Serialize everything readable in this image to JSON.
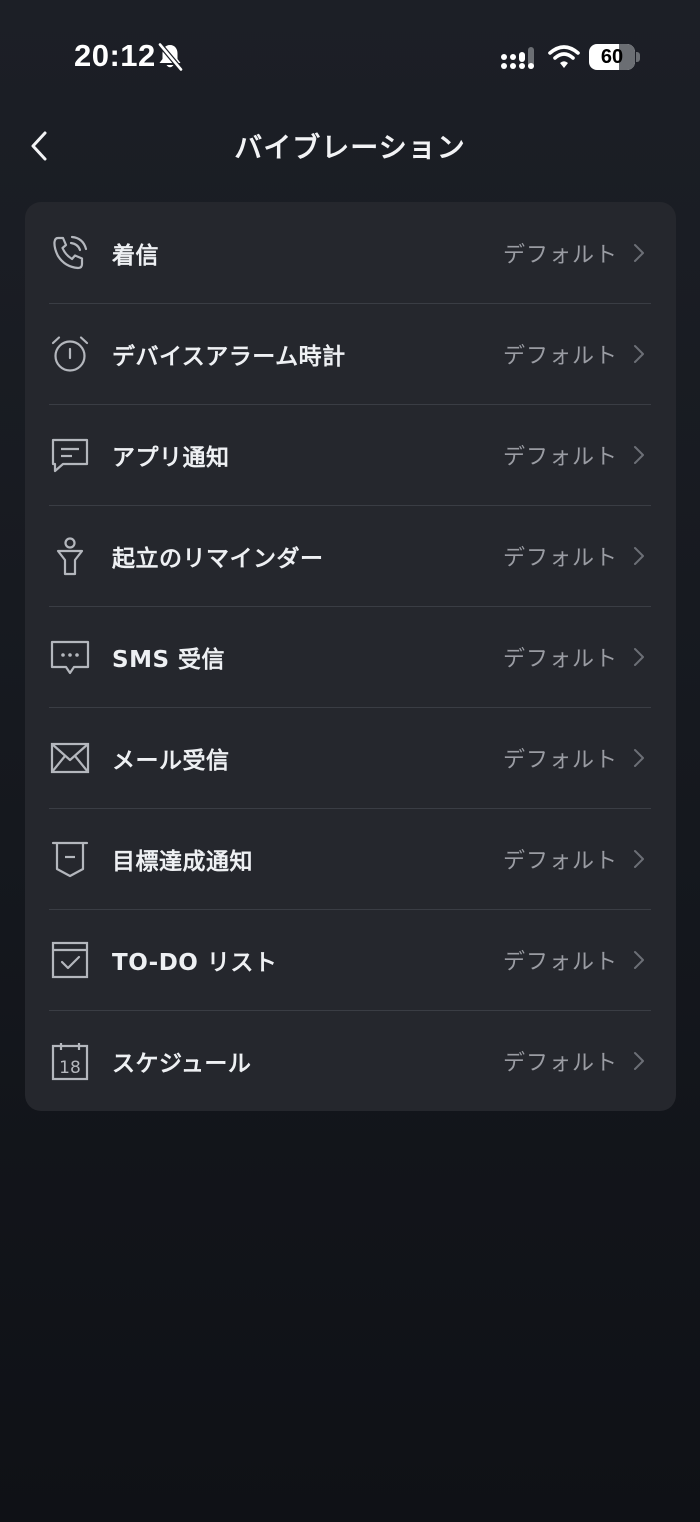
{
  "status_bar": {
    "time": "20:12",
    "battery": "60",
    "icons": [
      "bell-slash-icon",
      "cellular-signal-icon",
      "wifi-icon",
      "battery-icon"
    ]
  },
  "header": {
    "title": "バイブレーション",
    "back_icon": "chevron-left-icon"
  },
  "items": [
    {
      "icon": "phone-ringing-icon",
      "label": "着信",
      "value": "デフォルト"
    },
    {
      "icon": "alarm-clock-icon",
      "label": "デバイスアラーム時計",
      "value": "デフォルト"
    },
    {
      "icon": "chat-bubble-icon",
      "label": "アプリ通知",
      "value": "デフォルト"
    },
    {
      "icon": "standing-person-icon",
      "label": "起立のリマインダー",
      "value": "デフォルト"
    },
    {
      "icon": "sms-bubble-icon",
      "label": "SMS 受信",
      "value": "デフォルト"
    },
    {
      "icon": "mail-icon",
      "label": "メール受信",
      "value": "デフォルト"
    },
    {
      "icon": "goal-badge-icon",
      "label": "目標達成通知",
      "value": "デフォルト"
    },
    {
      "icon": "todo-checkbox-icon",
      "label": "TO-DO リスト",
      "value": "デフォルト"
    },
    {
      "icon": "calendar-icon",
      "label": "スケジュール",
      "value": "デフォルト",
      "icon_text": "18"
    }
  ],
  "colors": {
    "background": "#1a1d23",
    "card": "#25272d",
    "label": "#eef0f3",
    "value": "#9a9ca3",
    "divider": "#3a3d44"
  }
}
